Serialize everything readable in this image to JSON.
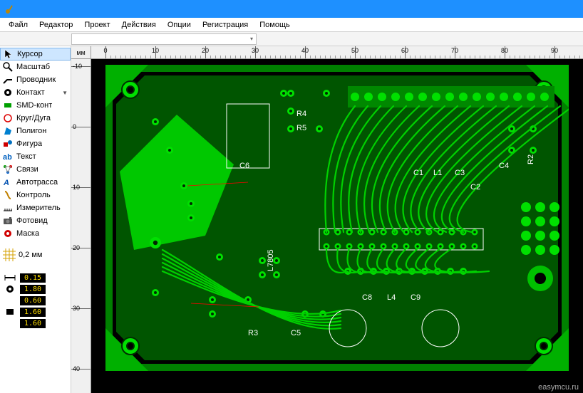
{
  "titlebar": {
    "app_icon_name": "app-icon"
  },
  "menu": {
    "items": [
      "Файл",
      "Редактор",
      "Проект",
      "Действия",
      "Опции",
      "Регистрация",
      "Помощь"
    ]
  },
  "ruler": {
    "unit": "мм",
    "h_ticks": [
      "0",
      "10",
      "20",
      "30",
      "40",
      "50",
      "60",
      "70",
      "80",
      "90"
    ],
    "v_ticks": [
      "-10",
      "0",
      "10",
      "20",
      "30",
      "40"
    ]
  },
  "tools": [
    {
      "id": "cursor",
      "label": "Курсор",
      "icon": "cursor-icon",
      "selected": true,
      "dropdown": false
    },
    {
      "id": "zoom",
      "label": "Масштаб",
      "icon": "zoom-icon",
      "selected": false,
      "dropdown": false
    },
    {
      "id": "track",
      "label": "Проводник",
      "icon": "track-icon",
      "selected": false,
      "dropdown": false
    },
    {
      "id": "pad",
      "label": "Контакт",
      "icon": "pad-icon",
      "selected": false,
      "dropdown": true
    },
    {
      "id": "smd",
      "label": "SMD-конт",
      "icon": "smd-icon",
      "selected": false,
      "dropdown": false
    },
    {
      "id": "circle",
      "label": "Круг/Дуга",
      "icon": "circle-icon",
      "selected": false,
      "dropdown": false
    },
    {
      "id": "polygon",
      "label": "Полигон",
      "icon": "polygon-icon",
      "selected": false,
      "dropdown": false
    },
    {
      "id": "shape",
      "label": "Фигура",
      "icon": "shape-icon",
      "selected": false,
      "dropdown": false
    },
    {
      "id": "text",
      "label": "Текст",
      "icon": "text-icon",
      "selected": false,
      "dropdown": false
    },
    {
      "id": "net",
      "label": "Связи",
      "icon": "net-icon",
      "selected": false,
      "dropdown": false
    },
    {
      "id": "autoroute",
      "label": "Автотрасса",
      "icon": "autoroute-icon",
      "selected": false,
      "dropdown": false
    },
    {
      "id": "inspect",
      "label": "Контроль",
      "icon": "inspect-icon",
      "selected": false,
      "dropdown": false
    },
    {
      "id": "measure",
      "label": "Измеритель",
      "icon": "measure-icon",
      "selected": false,
      "dropdown": false
    },
    {
      "id": "photoview",
      "label": "Фотовид",
      "icon": "camera-icon",
      "selected": false,
      "dropdown": false
    },
    {
      "id": "mask",
      "label": "Маска",
      "icon": "mask-icon",
      "selected": false,
      "dropdown": false
    }
  ],
  "grid": {
    "label": "0,2 мм"
  },
  "params": {
    "track_width": "0.15",
    "pad_outer": "1.80",
    "pad_inner": "0.60",
    "smd_w": "1.60",
    "smd_h": "1.60"
  },
  "board": {
    "component_labels": [
      "R4",
      "R5",
      "C6",
      "R2",
      "C1",
      "L1",
      "C3",
      "C2",
      "C4",
      "R3",
      "C5",
      "C8",
      "L4",
      "C9",
      "L7805"
    ]
  },
  "watermark": "easymcu.ru"
}
